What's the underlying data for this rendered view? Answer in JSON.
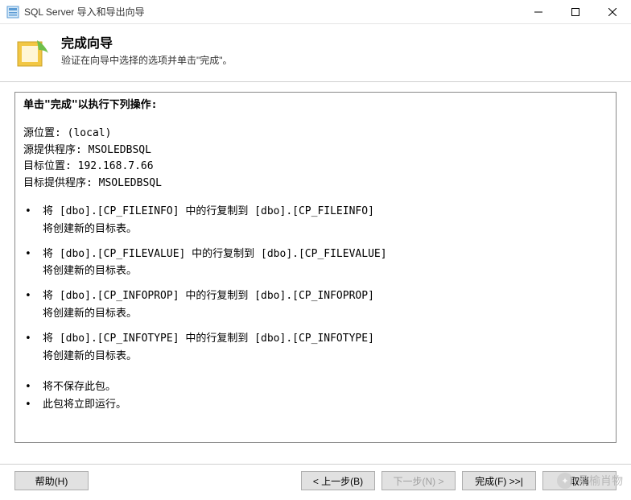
{
  "window": {
    "title": "SQL Server 导入和导出向导"
  },
  "header": {
    "title": "完成向导",
    "subtitle": "验证在向导中选择的选项并单击\"完成\"。"
  },
  "content": {
    "heading": "单击\"完成\"以执行下列操作:",
    "meta": {
      "source_loc_label": "源位置:",
      "source_loc_value": "(local)",
      "source_prov_label": "源提供程序:",
      "source_prov_value": "MSOLEDBSQL",
      "target_loc_label": "目标位置:",
      "target_loc_value": "192.168.7.66",
      "target_prov_label": "目标提供程序:",
      "target_prov_value": "MSOLEDBSQL"
    },
    "ops": [
      {
        "line": "将 [dbo].[CP_FILEINFO] 中的行复制到 [dbo].[CP_FILEINFO]",
        "sub": "将创建新的目标表。"
      },
      {
        "line": "将 [dbo].[CP_FILEVALUE] 中的行复制到 [dbo].[CP_FILEVALUE]",
        "sub": "将创建新的目标表。"
      },
      {
        "line": "将 [dbo].[CP_INFOPROP] 中的行复制到 [dbo].[CP_INFOPROP]",
        "sub": "将创建新的目标表。"
      },
      {
        "line": "将 [dbo].[CP_INFOTYPE] 中的行复制到 [dbo].[CP_INFOTYPE]",
        "sub": "将创建新的目标表。"
      }
    ],
    "tail": [
      "将不保存此包。",
      "此包将立即运行。"
    ]
  },
  "buttons": {
    "help": "帮助(H)",
    "back": "< 上一步(B)",
    "next": "下一步(N) >",
    "finish": "完成(F) >>|",
    "cancel": "取消"
  },
  "watermark": "桑榆肖物"
}
